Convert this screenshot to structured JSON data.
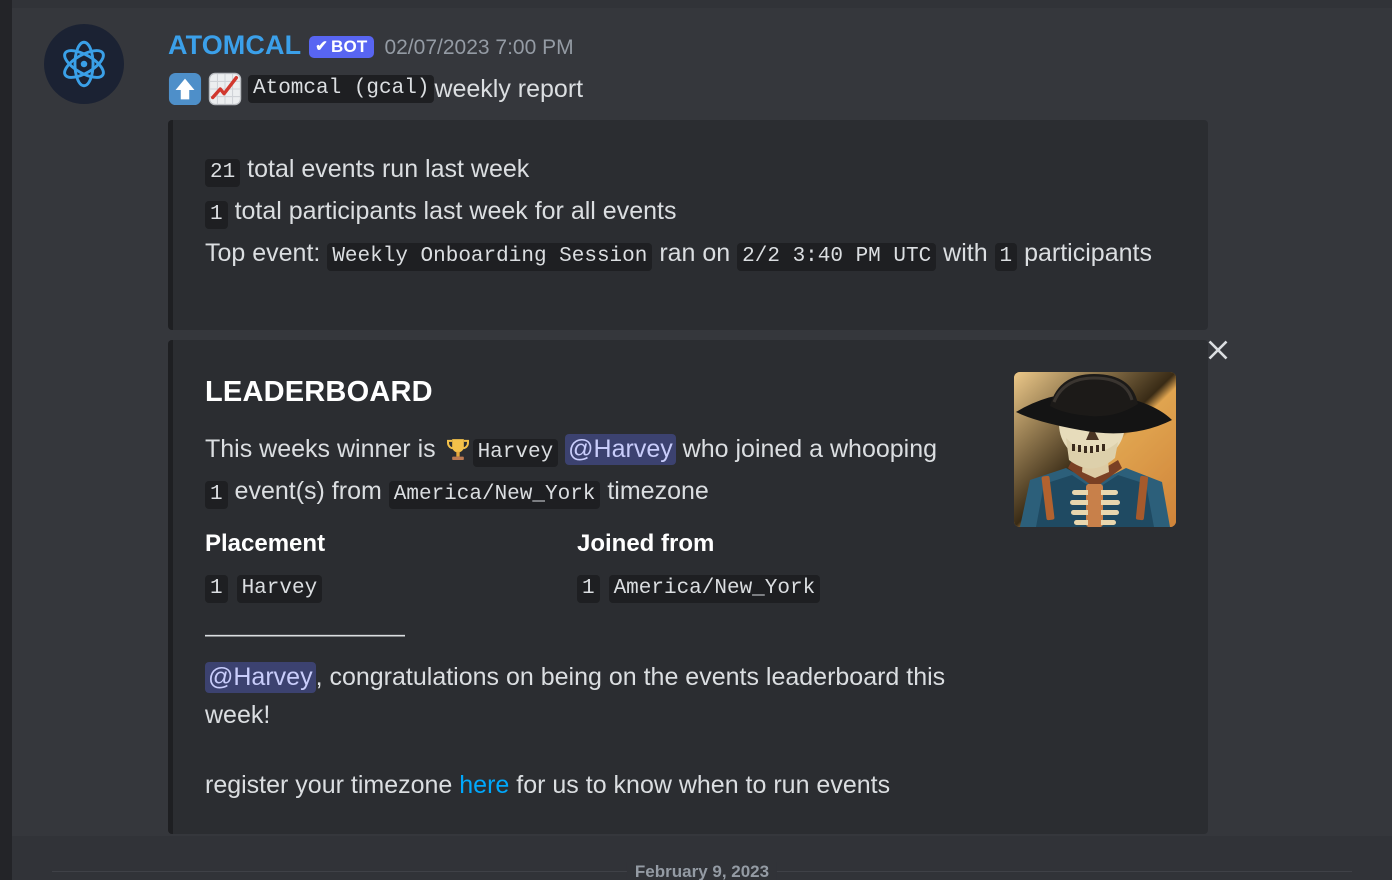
{
  "message": {
    "author": "ATOMCAL",
    "bot_tag": "BOT",
    "bot_check_glyph": "✔",
    "timestamp": "02/07/2023 7:00 PM",
    "avatar_name": "atom-logo-avatar",
    "title": {
      "emoji_1": "up-arrow-emoji",
      "emoji_2": "chart-increasing-emoji",
      "code_text": "Atomcal (gcal)",
      "suffix": " weekly report"
    }
  },
  "embed_1": {
    "line_1": {
      "count": "21",
      "text": "total events run last week"
    },
    "line_2": {
      "count": "1",
      "text": "total participants last week for all events"
    },
    "line_3": {
      "prefix": "Top event: ",
      "event_name": "Weekly Onboarding Session",
      "middle": " ran on ",
      "event_time": "2/2 3:40 PM UTC",
      "with": " with ",
      "participants": "1",
      "suffix": " participants"
    }
  },
  "embed_2": {
    "title": "LEADERBOARD",
    "description": {
      "part_1": "This weeks winner is ",
      "trophy_emoji": "trophy-emoji",
      "winner_code": "Harvey",
      "winner_mention": "@Harvey",
      "part_2": " who joined a whooping ",
      "event_count": "1",
      "part_3": " event(s) from ",
      "timezone": "America/New_York",
      "part_4": " timezone"
    },
    "fields": [
      {
        "name": "Placement",
        "rank": "1",
        "value": "Harvey"
      },
      {
        "name": "Joined from",
        "rank": "1",
        "value": "America/New_York"
      }
    ],
    "divider": "————————",
    "footer_text": {
      "mention": "@Harvey",
      "text": ", congratulations on being on the events leaderboard this week!"
    },
    "register_text": {
      "prefix": "register your timezone ",
      "link_label": "here",
      "suffix": " for us to know when to run events"
    },
    "thumbnail_name": "skeleton-cowboy-artwork-thumbnail"
  },
  "close_button": {
    "name": "close-icon",
    "glyph": "✕"
  },
  "date_divider": {
    "label": "February 9, 2023"
  },
  "colors": {
    "accent_username": "#3ba0ea",
    "bot_tag_bg": "#5865f2",
    "link": "#00a8fc",
    "mention_bg": "#3c4270",
    "mention_text": "#c9cdfb",
    "embed_bg": "#2b2d31",
    "code_bg": "#1e1f22",
    "message_hover_bg": "#35373c",
    "channel_bg": "#313338"
  }
}
